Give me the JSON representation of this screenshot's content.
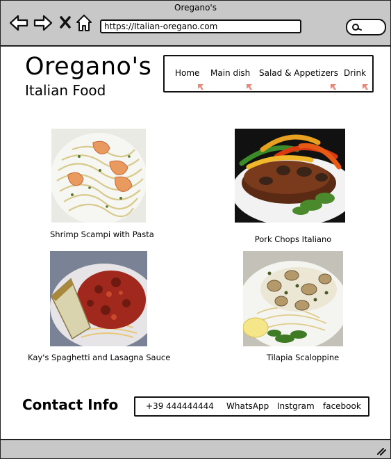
{
  "browser": {
    "window_title": "Oregano's",
    "url": "https://Italian-oregano.com",
    "icons": [
      "back-arrow-icon",
      "forward-arrow-icon",
      "close-icon",
      "home-icon",
      "search-icon"
    ]
  },
  "header": {
    "logo": "Oregano's",
    "tagline": "Italian Food"
  },
  "nav": {
    "items": [
      "Home",
      "Main dish",
      "Salad & Appetizers",
      "Drink"
    ]
  },
  "dishes": [
    {
      "name": "Shrimp Scampi with Pasta"
    },
    {
      "name": "Pork Chops Italiano"
    },
    {
      "name": "Kay's Spaghetti and Lasagna Sauce"
    },
    {
      "name": "Tilapia Scaloppine"
    }
  ],
  "contact": {
    "title": "Contact Info",
    "items": [
      "+39 444444444",
      "WhatsApp",
      "Instgram",
      "facebook"
    ]
  },
  "colors": {
    "chrome": "#c8c8c8",
    "cursor": "#e8877a"
  }
}
